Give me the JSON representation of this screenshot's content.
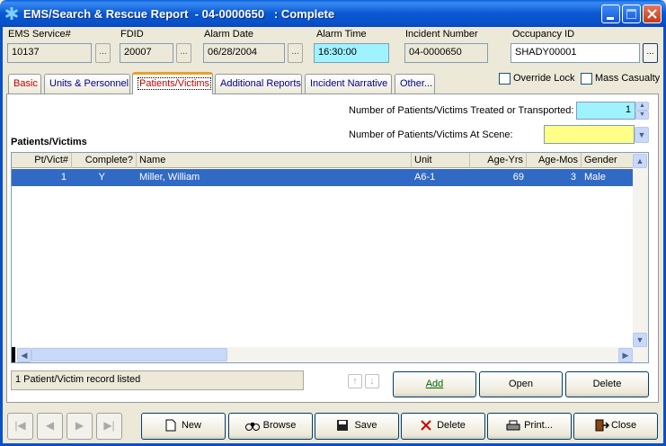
{
  "window": {
    "title": "EMS/Search & Rescue Report  - 04-0000650   : Complete"
  },
  "header_fields": {
    "ems_service_label": "EMS Service#",
    "ems_service_value": "10137",
    "fdid_label": "FDID",
    "fdid_value": "20007",
    "alarm_date_label": "Alarm Date",
    "alarm_date_value": "06/28/2004",
    "alarm_time_label": "Alarm Time",
    "alarm_time_value": "16:30:00",
    "incident_number_label": "Incident Number",
    "incident_number_value": "04-0000650",
    "occupancy_id_label": "Occupancy ID",
    "occupancy_id_value": "SHADY00001",
    "ellipsis": "..."
  },
  "tabs": [
    {
      "label": "Basic"
    },
    {
      "label": "Units & Personnel"
    },
    {
      "label": "Patients/Victims"
    },
    {
      "label": "Additional Reports"
    },
    {
      "label": "Incident Narrative"
    },
    {
      "label": "Other..."
    }
  ],
  "checkboxes": {
    "override_lock": "Override Lock",
    "mass_casualty": "Mass Casualty"
  },
  "patients": {
    "treated_label": "Number of Patients/Victims Treated or Transported:",
    "treated_value": "1",
    "at_scene_label": "Number of Patients/Victims At Scene:",
    "at_scene_value": "",
    "section_title": "Patients/Victims",
    "columns": [
      "Pt/Vict#",
      "Complete?",
      "Name",
      "Unit",
      "Age-Yrs",
      "Age-Mos",
      "Gender"
    ],
    "rows": [
      {
        "pt": "1",
        "complete": "Y",
        "name": "Miller, William",
        "unit": "A6-1",
        "age_yrs": "69",
        "age_mos": "3",
        "gender": "Male"
      }
    ],
    "status": "1 Patient/Victim record listed"
  },
  "panel_buttons": {
    "add": "Add",
    "open": "Open",
    "delete": "Delete"
  },
  "bottom_buttons": {
    "new": "New",
    "browse": "Browse",
    "save": "Save",
    "delete": "Delete",
    "print": "Print...",
    "close": "Close"
  },
  "colors": {
    "title_bar": "#0a58d2",
    "selection": "#316ac5",
    "alarm_time_bg": "#9ff3ff",
    "at_scene_bg": "#ffff88"
  }
}
